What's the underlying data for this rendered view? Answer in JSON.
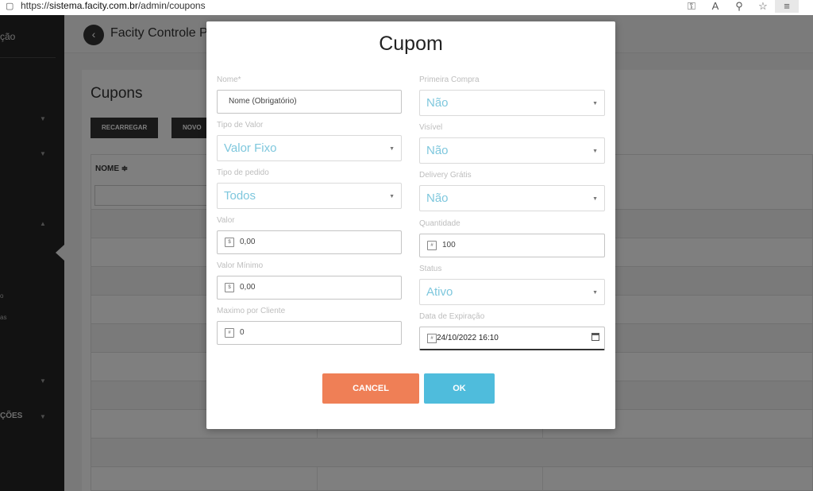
{
  "browser": {
    "url_prefix": "https://",
    "url_host": "sistema.facity.com.br",
    "url_path": "/admin/coupons",
    "icons": [
      "key-icon",
      "read-aloud-icon",
      "zoom-icon",
      "favorites-icon",
      "collections-icon"
    ]
  },
  "sidebar": {
    "title_fragment": "ção",
    "small_items": [
      "o",
      "as"
    ],
    "bottom_label": "ÇÕES"
  },
  "header": {
    "title": "Facity Controle P"
  },
  "page": {
    "title": "Cupons",
    "reload_button": "RECARREGAR",
    "new_button": "NOVO",
    "table": {
      "column_header": "NOME ≑"
    }
  },
  "modal": {
    "title": "Cupom",
    "fields": {
      "nome": {
        "label": "Nome*",
        "value": "Nome (Obrigatório)"
      },
      "tipo_valor": {
        "label": "Tipo de Valor",
        "value": "Valor Fixo"
      },
      "tipo_pedido": {
        "label": "Tipo de pedido",
        "value": "Todos"
      },
      "valor": {
        "label": "Valor",
        "value": "0,00"
      },
      "valor_minimo": {
        "label": "Valor Mínimo",
        "value": "0,00"
      },
      "maximo_cliente": {
        "label": "Maximo por Cliente",
        "value": "0"
      },
      "primeira_compra": {
        "label": "Primeira Compra",
        "value": "Não"
      },
      "visivel": {
        "label": "Visível",
        "value": "Não"
      },
      "delivery_gratis": {
        "label": "Delivery Grátis",
        "value": "Não"
      },
      "quantidade": {
        "label": "Quantidade",
        "value": "100"
      },
      "status": {
        "label": "Status",
        "value": "Ativo"
      },
      "data_expiracao": {
        "label": "Data de Expiração",
        "value": "24/10/2022 16:10"
      }
    },
    "cancel_button": "CANCEL",
    "ok_button": "OK"
  },
  "colors": {
    "accent_select_text": "#7ec7dd",
    "cancel": "#ef7f56",
    "ok": "#4fbcdc",
    "sidebar": "#252525"
  }
}
